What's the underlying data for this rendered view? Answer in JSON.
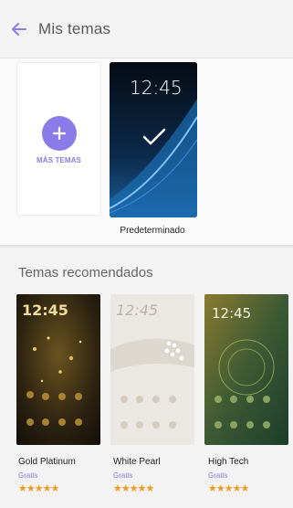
{
  "header": {
    "title": "Mis temas"
  },
  "my_themes": {
    "add_label": "MÁS TEMAS",
    "default_theme": {
      "name": "Predeterminado",
      "clock": "12:45"
    }
  },
  "recommended": {
    "title": "Temas recomendados",
    "items": [
      {
        "name": "Gold Platinum",
        "price": "Gratis",
        "stars": "★★★★★",
        "clock": "12:45"
      },
      {
        "name": "White Pearl",
        "price": "Gratis",
        "stars": "★★★★★",
        "clock": "12:45"
      },
      {
        "name": "High Tech",
        "price": "Gratis",
        "stars": "★★★★★",
        "clock": "12:45"
      }
    ]
  },
  "colors": {
    "accent": "#8b7be8",
    "stars": "#f19a1c"
  }
}
